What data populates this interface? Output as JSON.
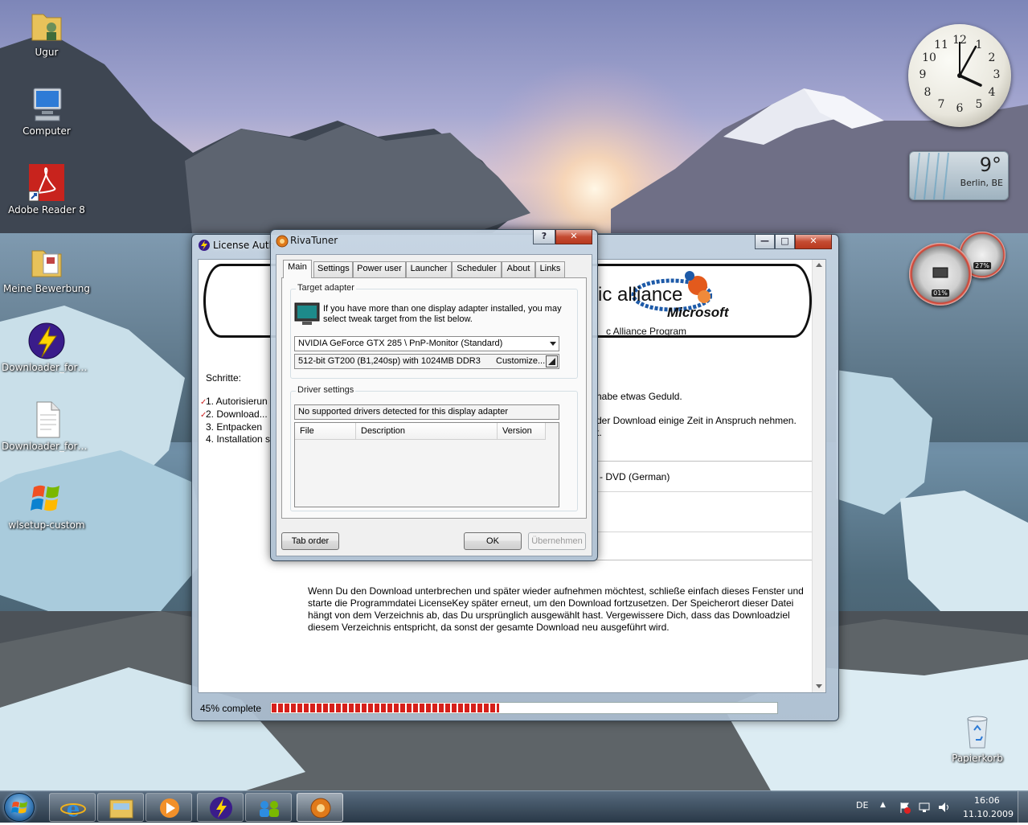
{
  "desktop": {
    "icons": [
      {
        "label": "Ugur"
      },
      {
        "label": "Computer"
      },
      {
        "label": "Adobe Reader 8"
      },
      {
        "label": "Meine Bewerbung"
      },
      {
        "label": "Downloader_for_W..."
      },
      {
        "label": "Downloader_for_W..."
      },
      {
        "label": "wlsetup-custom"
      },
      {
        "label": "Papierkorb"
      }
    ]
  },
  "gadgets": {
    "clock": {
      "numbers": [
        "12",
        "1",
        "2",
        "3",
        "4",
        "5",
        "6",
        "7",
        "8",
        "9",
        "10",
        "11"
      ],
      "time_shown": "16:06"
    },
    "weather": {
      "temperature": "9°",
      "city": "Berlin, BE"
    },
    "meters": {
      "cpu": "01%",
      "memory": "27%"
    }
  },
  "bg_window": {
    "title": "License Auth",
    "banner": {
      "alliance_text": "ic alliance",
      "microsoft_text": "Microsoft",
      "program_text": "c Alliance Program"
    },
    "steps_heading": "Schritte:",
    "steps": [
      {
        "text": "1. Autorisierun",
        "checked": true
      },
      {
        "text": "2. Download...",
        "checked": true
      },
      {
        "text": "3. Entpacken",
        "checked": false
      },
      {
        "text": "4. Installation s",
        "checked": false
      }
    ],
    "right_line_1": "habe etwas Geduld.",
    "right_line_2a": "der Download einige Zeit in Anspruch nehmen.",
    "right_line_2b": "t.",
    "dl_item": "- DVD (German)",
    "info_paragraph": "Wenn Du den Download unterbrechen und später wieder aufnehmen möchtest, schließe einfach dieses Fenster und starte die Programmdatei LicenseKey später erneut, um den Download fortzusetzen. Der Speicherort dieser Datei hängt von dem Verzeichnis ab, das Du ursprünglich ausgewählt hast. Vergewissere Dich, dass das Downloadziel diesem Verzeichnis entspricht, da sonst der gesamte Download neu ausgeführt wird.",
    "status_text": "45% complete",
    "progress_fraction": 0.45,
    "caption_buttons": {
      "minimize": "—",
      "maximize": "□",
      "close": "✕"
    }
  },
  "riva": {
    "title": "RivaTuner",
    "help_button": "?",
    "close_button": "✕",
    "tabs": [
      "Main",
      "Settings",
      "Power user",
      "Launcher",
      "Scheduler",
      "About",
      "Links"
    ],
    "active_tab": "Main",
    "target_adapter": {
      "legend": "Target adapter",
      "hint": "If you have more than one display adapter installed, you may select tweak target from the list below.",
      "selected_adapter": "NVIDIA GeForce GTX 285 \\ PnP-Monitor (Standard)",
      "adapter_info": "512-bit GT200 (B1,240sp) with 1024MB DDR3",
      "customize_label": "Customize..."
    },
    "driver_settings": {
      "legend": "Driver settings",
      "status": "No supported drivers detected for this display adapter",
      "columns": [
        "File",
        "Description",
        "Version"
      ]
    },
    "buttons": {
      "tab_order": "Tab order",
      "ok": "OK",
      "apply": "Übernehmen"
    }
  },
  "taskbar": {
    "language": "DE",
    "time": "16:06",
    "date": "11.10.2009",
    "tray_arrow": "▲"
  }
}
